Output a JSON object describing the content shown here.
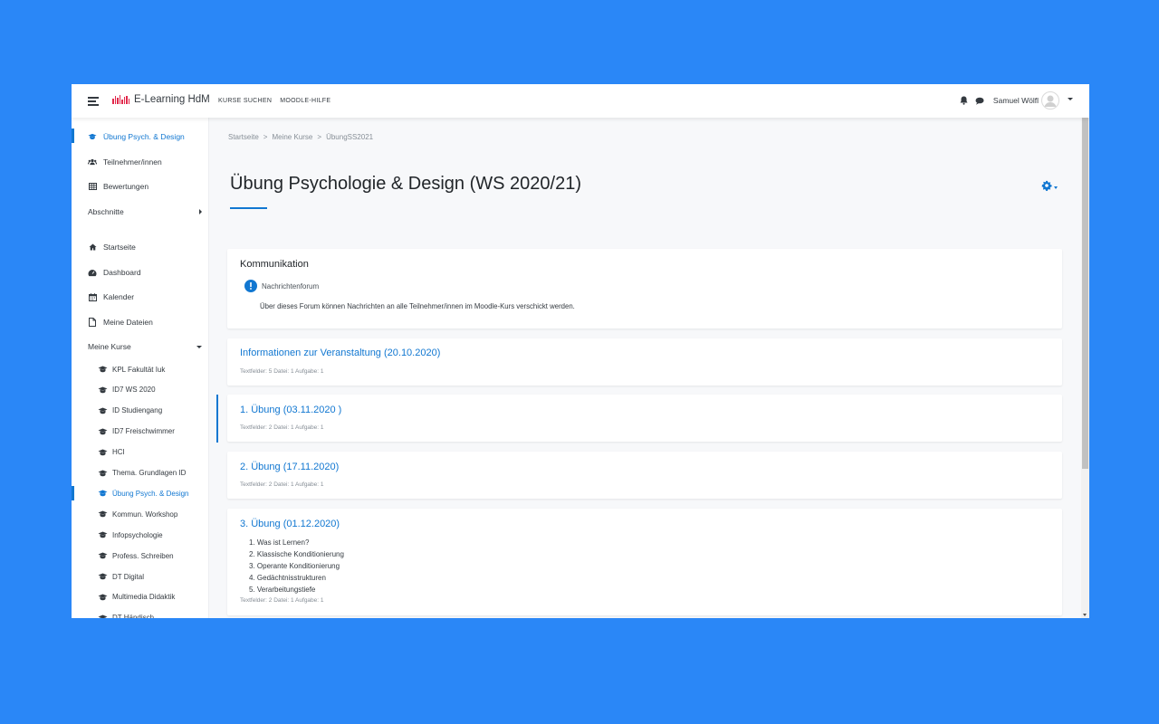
{
  "navbar": {
    "brand": "E-Learning HdM",
    "links": [
      "KURSE SUCHEN",
      "MOODLE-HILFE"
    ],
    "user_name": "Samuel Wölfl"
  },
  "sidebar": {
    "course_items": [
      {
        "label": "Übung Psych. & Design",
        "icon": "graduation-cap-icon",
        "active": true
      },
      {
        "label": "Teilnehmer/innen",
        "icon": "users-icon"
      },
      {
        "label": "Bewertungen",
        "icon": "table-icon"
      },
      {
        "label": "Abschnitte",
        "icon": ""
      }
    ],
    "nav_items": [
      {
        "label": "Startseite",
        "icon": "home-icon"
      },
      {
        "label": "Dashboard",
        "icon": "dashboard-icon"
      },
      {
        "label": "Kalender",
        "icon": "calendar-icon"
      },
      {
        "label": "Meine Dateien",
        "icon": "file-icon"
      },
      {
        "label": "Meine Kurse",
        "icon": ""
      }
    ],
    "my_courses": [
      "KPL Fakultät Iuk",
      "ID7 WS 2020",
      "ID Studiengang",
      "ID7 Freischwimmer",
      "HCI",
      "Thema. Grundlagen ID",
      "Übung Psych. & Design",
      "Kommun. Workshop",
      "Infopsychologie",
      "Profess. Schreiben",
      "DT Digital",
      "Multimedia Didaktik",
      "DT Händisch"
    ],
    "active_course_index": 6
  },
  "breadcrumb": [
    "Startseite",
    "Meine Kurse",
    "ÜbungSS2021"
  ],
  "page": {
    "title": "Übung Psychologie & Design (WS 2020/21)",
    "accent_color": "#1177d1"
  },
  "sections": {
    "communication": {
      "title": "Kommunikation",
      "forum_name": "Nachrichtenforum",
      "forum_description": "Über dieses Forum können Nachrichten an alle Teilnehmer/innen im Moodle-Kurs verschickt werden."
    },
    "info": {
      "title": "Informationen zur Veranstaltung (20.10.2020)",
      "meta": "Textfelder: 5  Datei: 1  Aufgabe: 1"
    },
    "uebung1": {
      "title": "1. Übung (03.11.2020 )",
      "meta": "Textfelder: 2  Datei: 1  Aufgabe: 1"
    },
    "uebung2": {
      "title": "2. Übung (17.11.2020)",
      "meta": "Textfelder: 2  Datei: 1  Aufgabe: 1"
    },
    "uebung3": {
      "title": "3. Übung (01.12.2020)",
      "topics": [
        "1. Was ist Lernen?",
        "2. Klassische Konditionierung",
        "3. Operante Konditionierung",
        "4. Gedächtnisstrukturen",
        "5. Verarbeitungstiefe"
      ],
      "meta": "Textfelder: 2  Datei: 1  Aufgabe: 1"
    }
  }
}
